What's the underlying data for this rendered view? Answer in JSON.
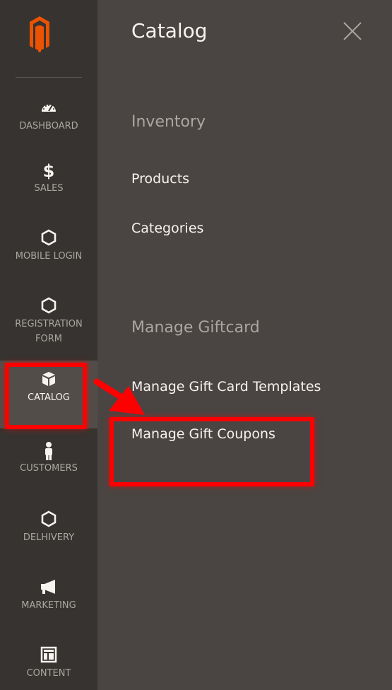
{
  "sidebar": {
    "logo_icon": "magento-logo-icon",
    "brand_color": "#eb5202",
    "items": [
      {
        "label": "DASHBOARD",
        "icon": "dashboard-gauge-icon"
      },
      {
        "label": "SALES",
        "icon": "dollar-icon"
      },
      {
        "label": "MOBILE LOGIN",
        "icon": "hexagon-icon"
      },
      {
        "label_line1": "REGISTRATION",
        "label_line2": "FORM",
        "icon": "hexagon-icon"
      },
      {
        "label": "CATALOG",
        "icon": "box-icon",
        "active": true
      },
      {
        "label": "CUSTOMERS",
        "icon": "person-icon"
      },
      {
        "label": "DELHIVERY",
        "icon": "hexagon-icon"
      },
      {
        "label": "MARKETING",
        "icon": "megaphone-icon"
      },
      {
        "label": "CONTENT",
        "icon": "layout-icon"
      }
    ]
  },
  "panel": {
    "title": "Catalog",
    "close_icon": "close-icon",
    "sections": [
      {
        "title": "Inventory",
        "links": [
          "Products",
          "Categories"
        ]
      },
      {
        "title": "Manage Giftcard",
        "links": [
          "Manage Gift Card Templates",
          "Manage Gift Coupons"
        ]
      }
    ]
  },
  "annotations": {
    "highlight_color": "#ff0000",
    "arrow_icon": "red-arrow-icon"
  }
}
